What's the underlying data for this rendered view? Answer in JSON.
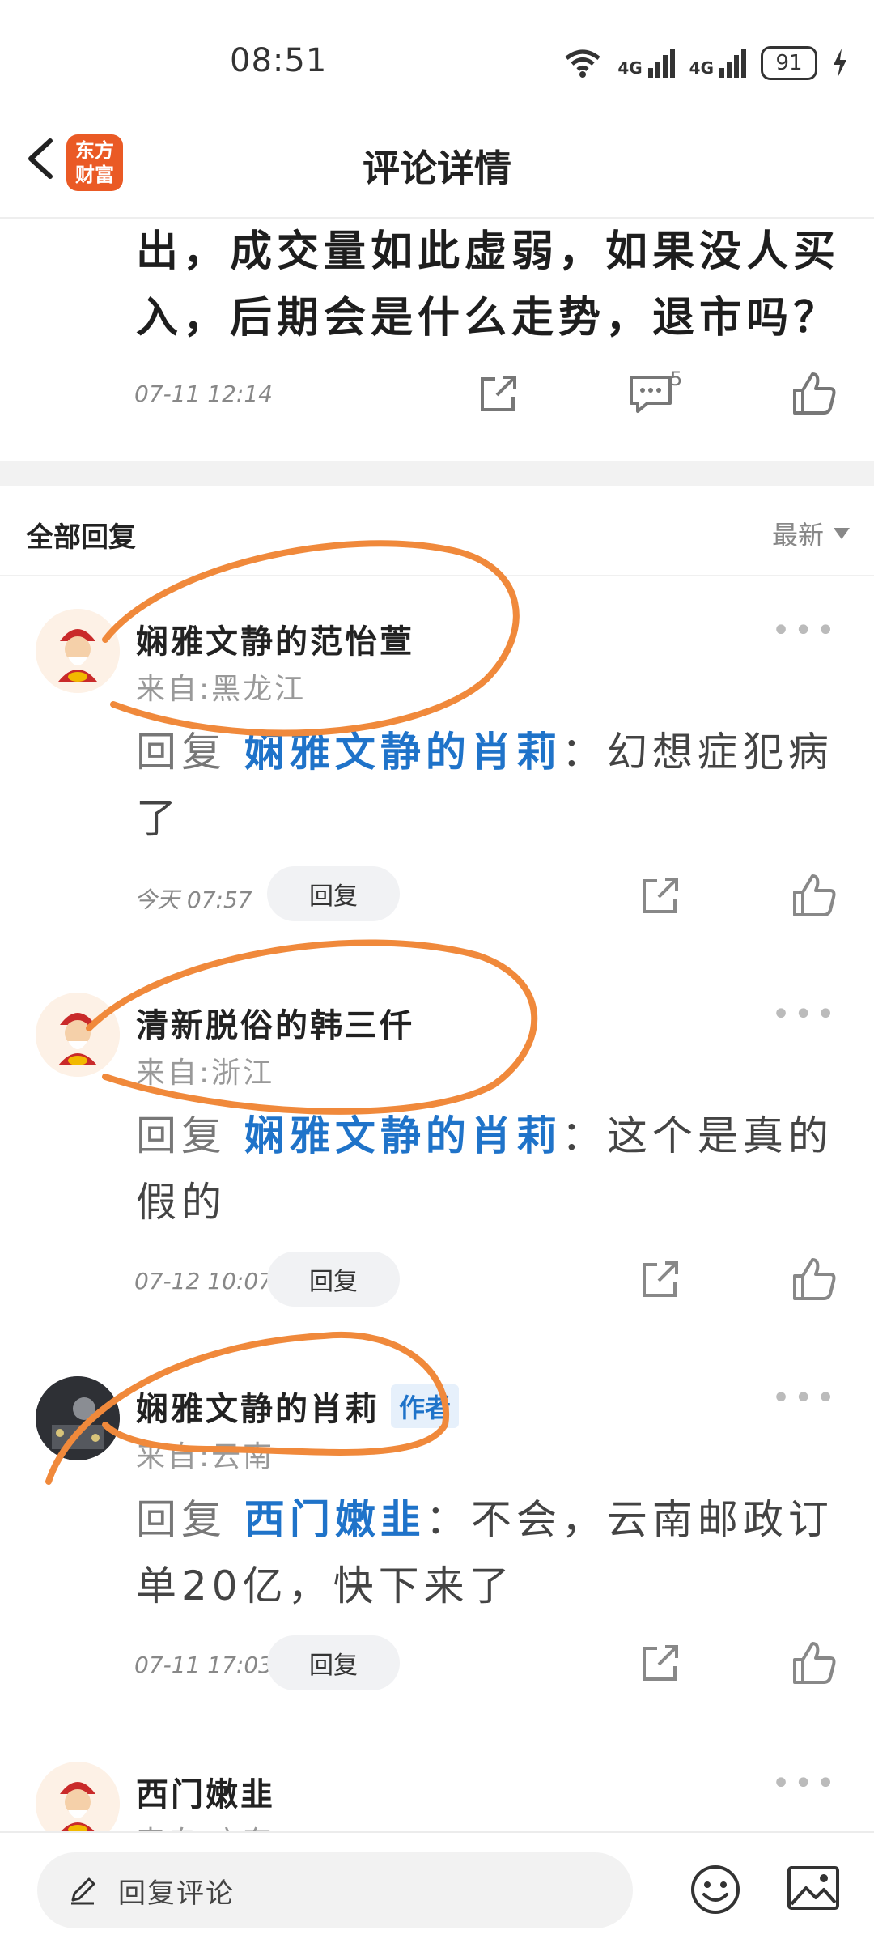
{
  "status_bar": {
    "time": "08:51",
    "battery": "91",
    "signal_1": "4G",
    "signal_2": "4G"
  },
  "header": {
    "title": "评论详情",
    "logo_line1": "东方",
    "logo_line2": "财富"
  },
  "post": {
    "text": "出，成交量如此虚弱，如果没人买入，后期会是什么走势，退市吗？",
    "time": "07-11 12:14",
    "comment_count": "5"
  },
  "replies_section": {
    "title": "全部回复",
    "sort_label": "最新"
  },
  "comments": [
    {
      "username": "娴雅文静的范怡萱",
      "location": "来自:黑龙江",
      "reply_prefix": "回复",
      "reply_target": "娴雅文静的肖莉",
      "separator": "：",
      "content": "幻想症犯病了",
      "time": "今天 07:57",
      "reply_button": "回复"
    },
    {
      "username": "清新脱俗的韩三仟",
      "location": "来自:浙江",
      "reply_prefix": "回复",
      "reply_target": "娴雅文静的肖莉",
      "separator": "：",
      "content": "这个是真的假的",
      "time": "07-12 10:07",
      "reply_button": "回复"
    },
    {
      "username": "娴雅文静的肖莉",
      "badge": "作者",
      "location": "来自:云南",
      "reply_prefix": "回复",
      "reply_target": "西门嫩韭",
      "separator": "：",
      "content": "不会，云南邮政订单20亿，快下来了",
      "time": "07-11 17:03",
      "reply_button": "回复"
    },
    {
      "username": "西门嫩韭",
      "location": "来自:广东"
    }
  ],
  "bottom_bar": {
    "placeholder": "回复评论"
  },
  "colors": {
    "accent_blue": "#1f73c9",
    "brand_orange": "#ea5a25",
    "annotation_orange": "#f0893b"
  }
}
